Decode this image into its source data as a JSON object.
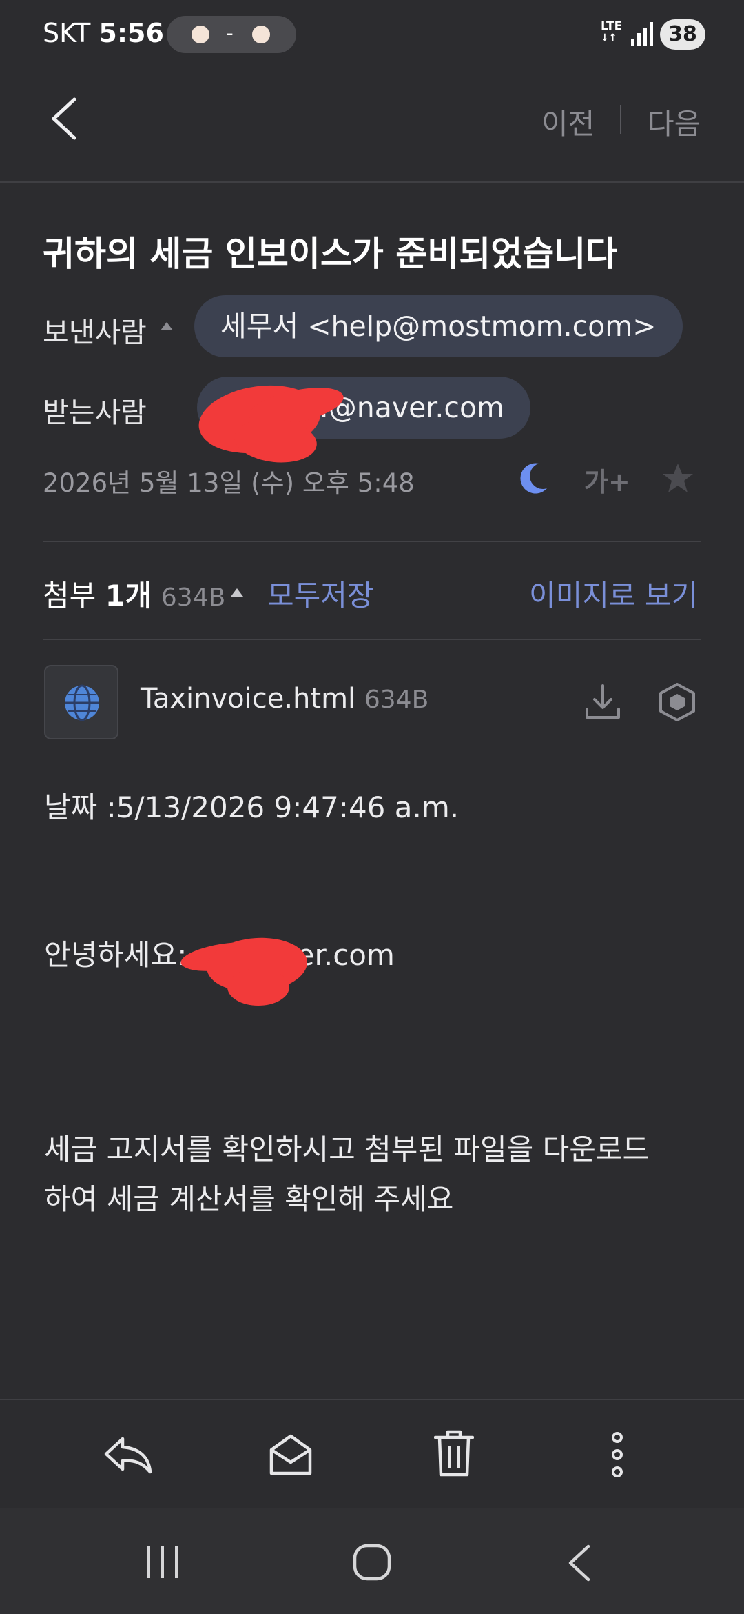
{
  "status_bar": {
    "carrier": "SKT",
    "time": "5:56",
    "pill_dash": "-",
    "network": "LTE",
    "battery": "38"
  },
  "header": {
    "prev_label": "이전",
    "next_label": "다음"
  },
  "email": {
    "subject": "귀하의 세금 인보이스가 준비되었습니다",
    "from_label": "보낸사람",
    "from_value": "세무서 <help@mostmom.com>",
    "to_label": "받는사람",
    "to_value": "...@naver.com",
    "date": "2026년 5월 13일 (수) 오후 5:48",
    "font_size_icon_label": "가+"
  },
  "attachments": {
    "title_prefix": "첨부 ",
    "count_label": "1개",
    "total_size": "634B",
    "save_all_label": "모두저장",
    "view_as_image_label": "이미지로 보기",
    "files": [
      {
        "name": "Taxinvoice.html",
        "size": "634B"
      }
    ]
  },
  "body": {
    "line_date": "날짜 :5/13/2026 9:47:46 a.m.",
    "greeting": "안녕하세요:...@naver.com",
    "message_line_1": "세금 고지서를 확인하시고 첨부된 파일을 다운로드",
    "message_line_2": "하여 세금 계산서를 확인해 주세요"
  },
  "toolbar": {
    "icons": [
      "reply-icon",
      "mark-unread-icon",
      "trash-icon",
      "more-icon"
    ]
  },
  "system_nav": {
    "icons": [
      "recent-apps-icon",
      "home-icon",
      "back-icon"
    ]
  },
  "colors": {
    "background": "#2c2c2f",
    "accent_link": "#7a8fd8",
    "chip_bg": "#3c4150",
    "redaction": "#f23a3a",
    "moon": "#6d8ff0",
    "globe": "#4f86d8"
  }
}
